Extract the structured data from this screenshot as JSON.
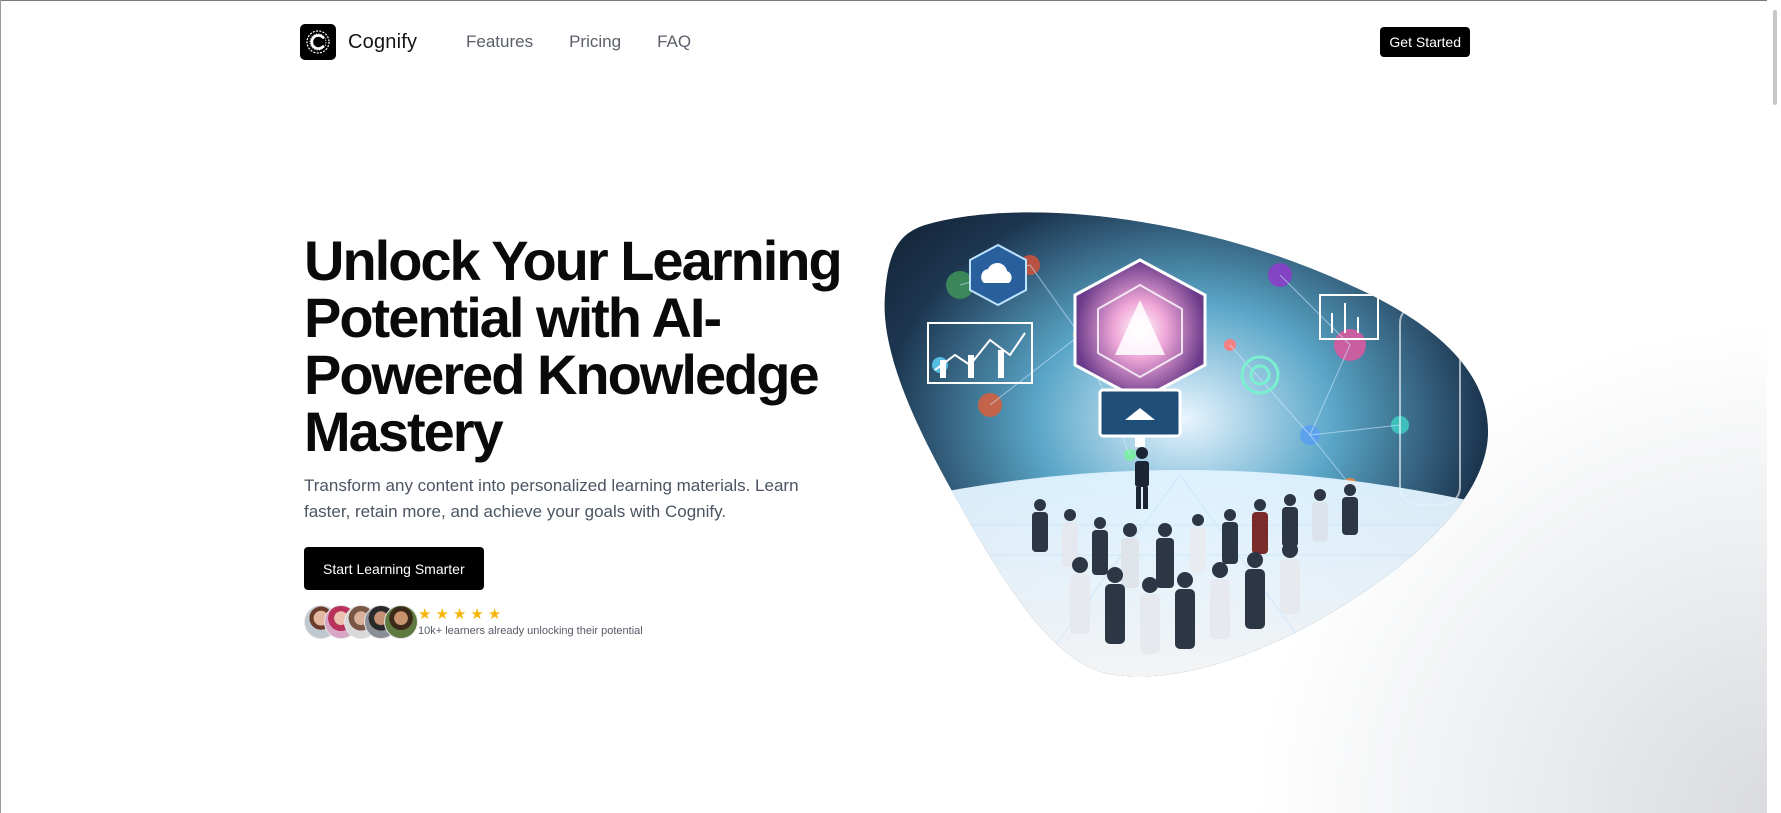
{
  "brand": {
    "name": "Cognify",
    "logo_letter": "C"
  },
  "nav": {
    "links": [
      "Features",
      "Pricing",
      "FAQ"
    ],
    "cta": "Get Started"
  },
  "hero": {
    "title": "Unlock Your Learning Potential with AI-Powered Knowledge Mastery",
    "subtitle": "Transform any content into personalized learning materials. Learn faster, retain more, and achieve your goals with Cognify.",
    "cta": "Start Learning Smarter",
    "rating_stars": 5,
    "social_proof": "10k+ learners already unlocking their potential",
    "avatar_count": 5
  },
  "colors": {
    "primary": "#000000",
    "star": "#f5b50b",
    "muted_text": "#4b5563",
    "nav_text": "#5a5f69"
  },
  "icons": {
    "logo": "cognify-logo-icon",
    "star": "star-icon"
  }
}
